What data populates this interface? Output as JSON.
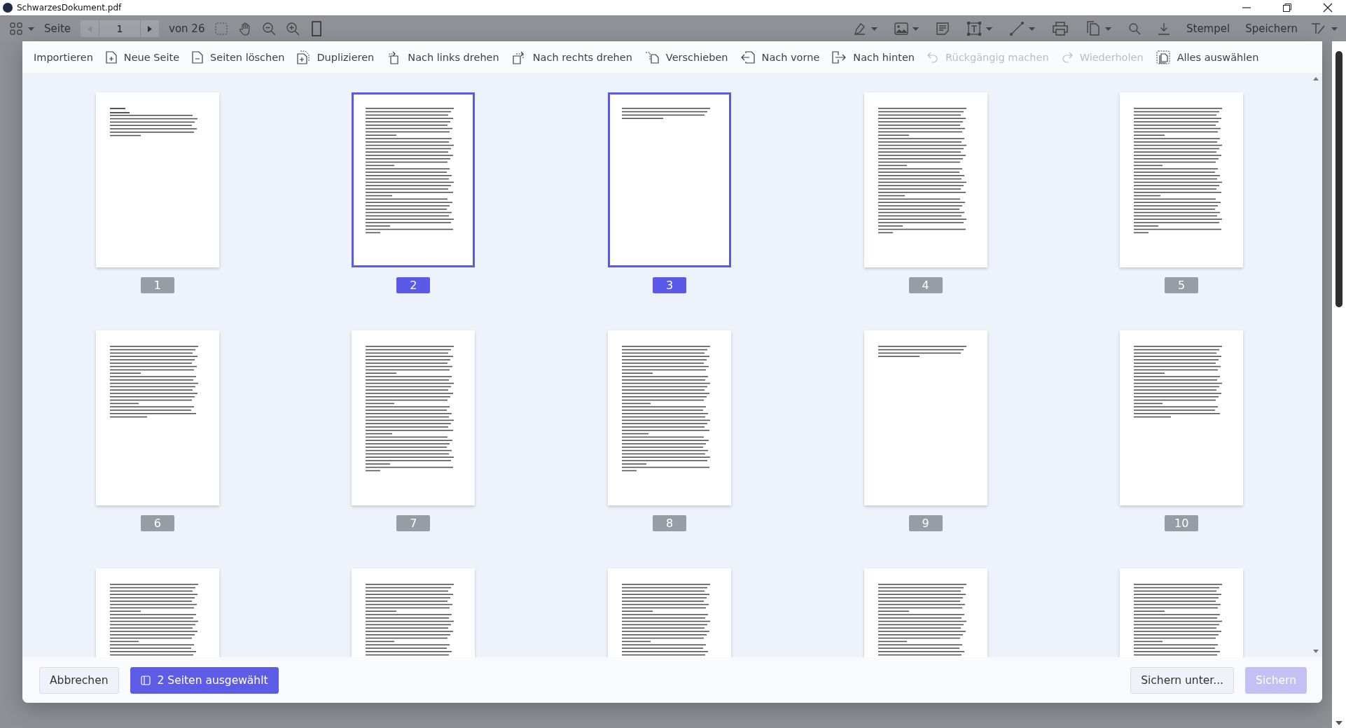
{
  "window": {
    "title": "SchwarzesDokument.pdf"
  },
  "app_toolbar": {
    "page_label": "Seite",
    "page_value": "1",
    "page_total": "von 26",
    "left_tools": [
      {
        "kind": "selection"
      },
      {
        "kind": "hand"
      },
      {
        "kind": "zoom-out"
      },
      {
        "kind": "zoom-in"
      },
      {
        "kind": "page-view"
      }
    ],
    "right_tools": [
      {
        "kind": "pen",
        "dropdown": true
      },
      {
        "kind": "image",
        "dropdown": true
      },
      {
        "kind": "note",
        "dropdown": false
      },
      {
        "kind": "textbox",
        "dropdown": true
      },
      {
        "kind": "line",
        "dropdown": true
      },
      {
        "kind": "print",
        "dropdown": false
      },
      {
        "kind": "copy",
        "dropdown": true
      },
      {
        "kind": "search",
        "dropdown": false
      },
      {
        "kind": "download",
        "dropdown": false
      }
    ],
    "text_buttons": [
      "Stempel",
      "Speichern"
    ]
  },
  "dialog": {
    "toolbar": [
      {
        "label": "Importieren",
        "kind": "none",
        "disabled": false
      },
      {
        "label": "Neue Seite",
        "kind": "page-plus",
        "disabled": false
      },
      {
        "label": "Seiten löschen",
        "kind": "page-minus",
        "disabled": false
      },
      {
        "label": "Duplizieren",
        "kind": "duplicate",
        "disabled": false
      },
      {
        "label": "Nach links drehen",
        "kind": "rotate-left",
        "disabled": false
      },
      {
        "label": "Nach rechts drehen",
        "kind": "rotate-right",
        "disabled": false
      },
      {
        "label": "Verschieben",
        "kind": "move",
        "disabled": false
      },
      {
        "label": "Nach vorne",
        "kind": "forward",
        "disabled": false
      },
      {
        "label": "Nach hinten",
        "kind": "backward",
        "disabled": false
      },
      {
        "label": "Rückgängig machen",
        "kind": "undo",
        "disabled": true
      },
      {
        "label": "Wiederholen",
        "kind": "redo",
        "disabled": true
      },
      {
        "label": "Alles auswählen",
        "kind": "select-all",
        "disabled": false
      }
    ],
    "pages": [
      {
        "label": "1",
        "selected": false,
        "kind": "cover"
      },
      {
        "label": "2",
        "selected": true,
        "kind": "full"
      },
      {
        "label": "3",
        "selected": true,
        "kind": "brief"
      },
      {
        "label": "4",
        "selected": false,
        "kind": "full"
      },
      {
        "label": "5",
        "selected": false,
        "kind": "full"
      },
      {
        "label": "6",
        "selected": false,
        "kind": "partial"
      },
      {
        "label": "7",
        "selected": false,
        "kind": "full"
      },
      {
        "label": "8",
        "selected": false,
        "kind": "full"
      },
      {
        "label": "9",
        "selected": false,
        "kind": "brief"
      },
      {
        "label": "10",
        "selected": false,
        "kind": "partial"
      },
      {
        "selected": false,
        "kind": "full"
      },
      {
        "selected": false,
        "kind": "full"
      },
      {
        "selected": false,
        "kind": "full"
      },
      {
        "selected": false,
        "kind": "full"
      },
      {
        "selected": false,
        "kind": "full"
      }
    ],
    "footer": {
      "cancel": "Abbrechen",
      "selection": "2 Seiten ausgewählt",
      "save_as": "Sichern unter...",
      "save": "Sichern",
      "save_disabled": true
    }
  }
}
